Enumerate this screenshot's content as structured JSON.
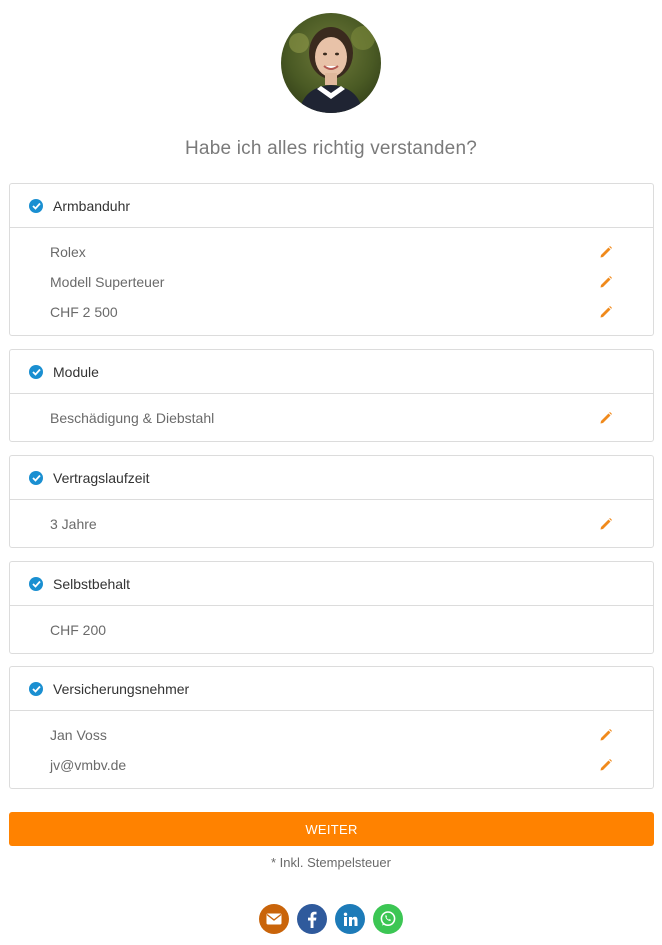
{
  "header": {
    "question": "Habe ich alles richtig verstanden?"
  },
  "sections": [
    {
      "title": "Armbanduhr",
      "rows": [
        {
          "label": "Rolex",
          "editable": true
        },
        {
          "label": "Modell Superteuer",
          "editable": true
        },
        {
          "label": "CHF 2 500",
          "editable": true
        }
      ]
    },
    {
      "title": "Module",
      "rows": [
        {
          "label": "Beschädigung & Diebstahl",
          "editable": true
        }
      ]
    },
    {
      "title": "Vertragslaufzeit",
      "rows": [
        {
          "label": "3 Jahre",
          "editable": true
        }
      ]
    },
    {
      "title": "Selbstbehalt",
      "rows": [
        {
          "label": "CHF 200",
          "editable": false
        }
      ]
    },
    {
      "title": "Versicherungsnehmer",
      "rows": [
        {
          "label": "Jan Voss",
          "editable": true
        },
        {
          "label": "jv@vmbv.de",
          "editable": true
        }
      ]
    }
  ],
  "actions": {
    "continue_label": "WEITER",
    "footnote": "* Inkl. Stempelsteuer"
  },
  "share": [
    {
      "name": "email-icon",
      "color": "#c9640a"
    },
    {
      "name": "facebook-icon",
      "color": "#2f5a9c"
    },
    {
      "name": "linkedin-icon",
      "color": "#1d7bb8"
    },
    {
      "name": "whatsapp-icon",
      "color": "#3cc654"
    }
  ],
  "colors": {
    "accent": "#ff8200",
    "check": "#1a8fd1",
    "edit": "#f08a1c"
  }
}
